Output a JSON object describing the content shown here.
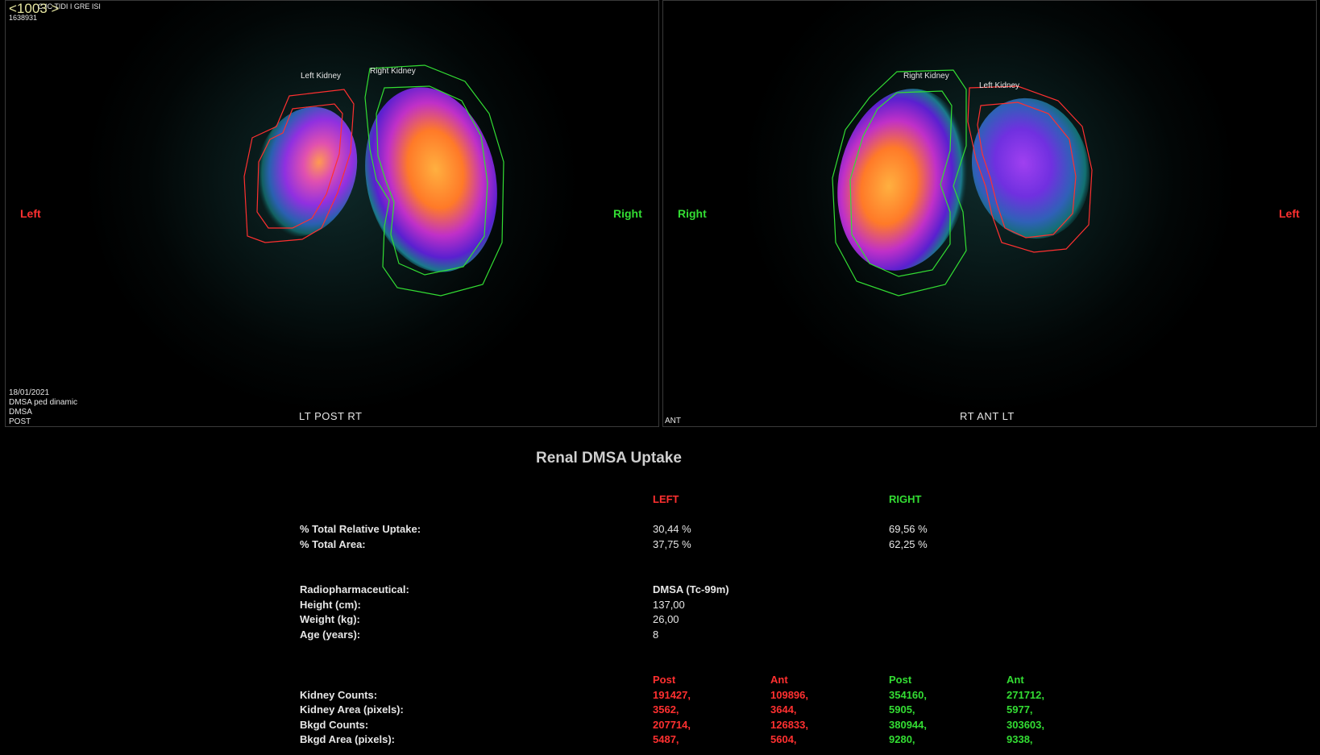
{
  "header": {
    "frame_number": "<1003 >",
    "overlay_text": "C IC TIDI I GRE ISI",
    "id": "1638931"
  },
  "panels": {
    "post": {
      "side_left": "Left",
      "side_right": "Right",
      "roi_left": "Left Kidney",
      "roi_right": "Right Kidney",
      "view": "LT  POST  RT",
      "info": {
        "date": "18/01/2021",
        "study": "DMSA ped dinamic",
        "agent": "DMSA",
        "projection": "POST"
      }
    },
    "ant": {
      "side_left": "Right",
      "side_right": "Left",
      "roi_left": "Right Kidney",
      "roi_right": "Left Kidney",
      "view": "RT  ANT  LT",
      "info_projection": "ANT"
    }
  },
  "report": {
    "title": "Renal DMSA Uptake",
    "col_left": "LEFT",
    "col_right": "RIGHT",
    "uptake_label": "% Total Relative Uptake:",
    "uptake_left": "30,44 %",
    "uptake_right": "69,56 %",
    "area_label": "% Total Area:",
    "area_left": "37,75 %",
    "area_right": "62,25 %",
    "radio_label": "Radiopharmaceutical:",
    "radio_value": "DMSA  (Tc-99m)",
    "height_label": "Height  (cm):",
    "height_value": "137,00",
    "weight_label": "Weight  (kg):",
    "weight_value": "26,00",
    "age_label": "Age (years):",
    "age_value": "8",
    "sub_headers": [
      "Post",
      "Ant",
      "Post",
      "Ant"
    ],
    "rows": [
      {
        "label": "Kidney Counts:",
        "values": [
          "191427,",
          "109896,",
          "354160,",
          "271712,"
        ]
      },
      {
        "label": "Kidney Area (pixels):",
        "values": [
          "3562,",
          "3644,",
          "5905,",
          "5977,"
        ]
      },
      {
        "label": "Bkgd Counts:",
        "values": [
          "207714,",
          "126833,",
          "380944,",
          "303603,"
        ]
      },
      {
        "label": "Bkgd Area (pixels):",
        "values": [
          "5487,",
          "5604,",
          "9280,",
          "9338,"
        ]
      }
    ]
  },
  "colors": {
    "left": "#ff3030",
    "right": "#33dd33",
    "background": "#000000"
  }
}
